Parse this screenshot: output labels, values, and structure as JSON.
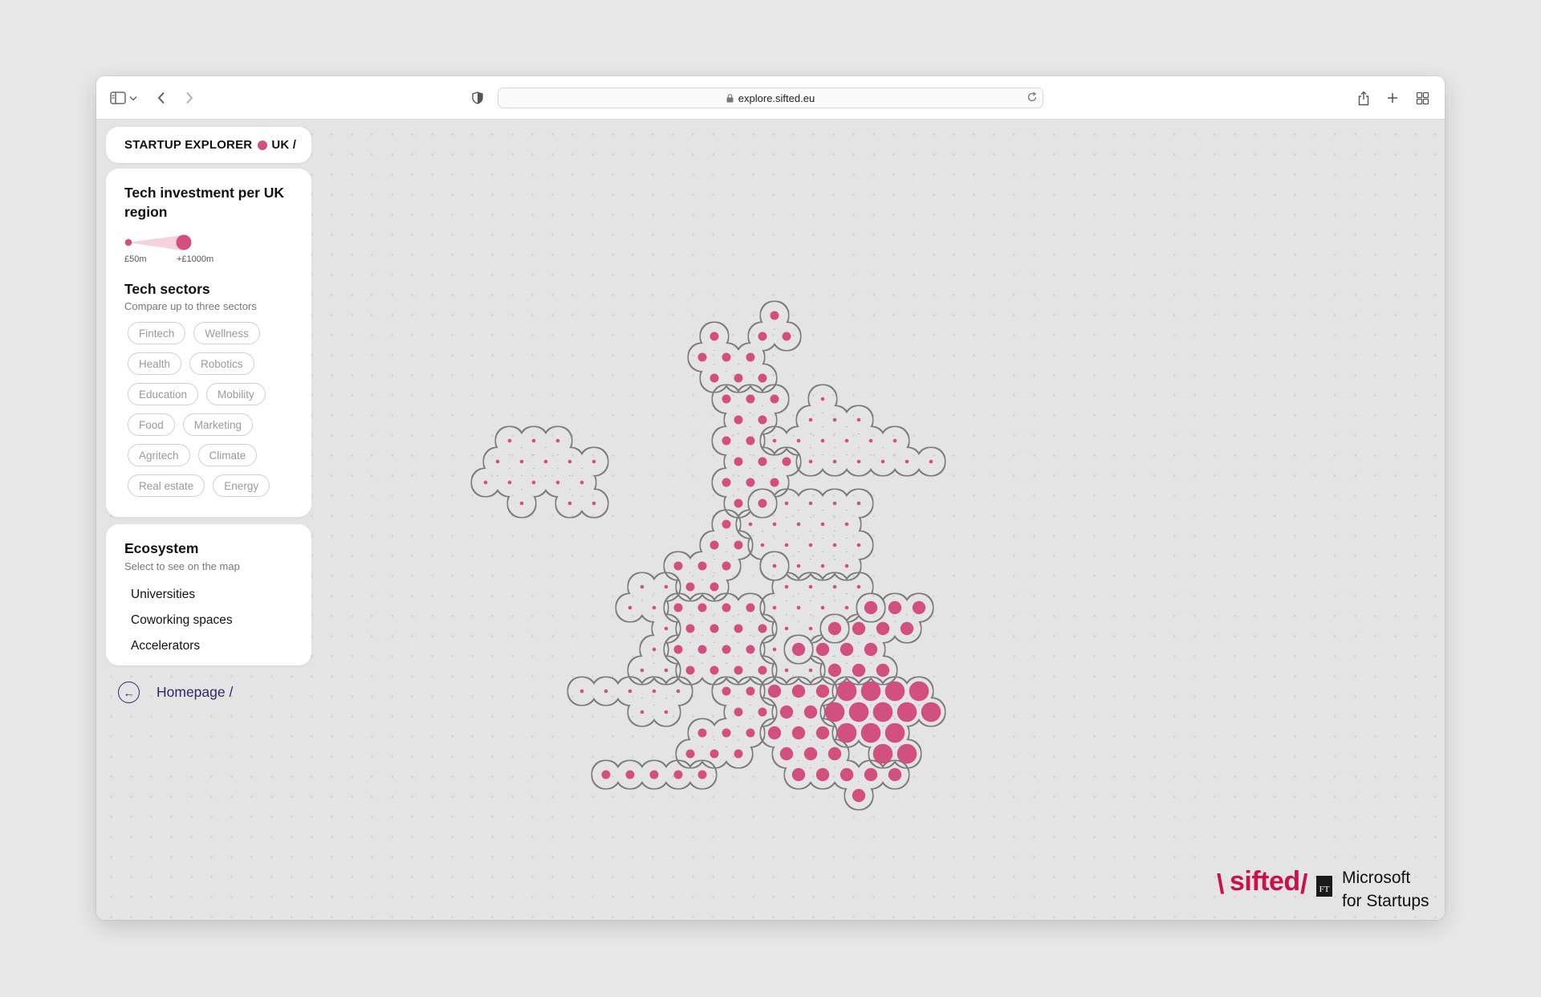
{
  "browser": {
    "url": "explore.sifted.eu",
    "icons": [
      "sidebar-icon",
      "chevron-down-icon",
      "back-icon",
      "forward-icon",
      "shield-icon",
      "lock-icon",
      "reload-icon",
      "share-icon",
      "plus-icon",
      "tabs-grid-icon"
    ]
  },
  "brand": {
    "title": "STARTUP EXPLORER",
    "suffix": "UK /",
    "dot_color": "#d1507f"
  },
  "investment": {
    "title": "Tech investment per UK region",
    "legend_min": "£50m",
    "legend_max": "+£1000m"
  },
  "sectors": {
    "title": "Tech sectors",
    "subtitle": "Compare up to three sectors",
    "rows": [
      [
        "Fintech",
        "Wellness"
      ],
      [
        "Health",
        "Robotics"
      ],
      [
        "Education",
        "Mobility"
      ],
      [
        "Food",
        "Marketing"
      ],
      [
        "Agritech",
        "Climate"
      ],
      [
        "Real estate",
        "Energy"
      ]
    ]
  },
  "ecosystem": {
    "title": "Ecosystem",
    "subtitle": "Select to see on the map",
    "items": [
      "Universities",
      "Coworking spaces",
      "Accelerators"
    ]
  },
  "home_link": "Homepage /",
  "map": {
    "dot_color": "#d1507f",
    "regions": [
      {
        "size": 1,
        "cells": [
          [
            12,
            0
          ],
          [
            9,
            1
          ],
          [
            11,
            1
          ],
          [
            12,
            1
          ],
          [
            9,
            2
          ],
          [
            10,
            2
          ],
          [
            11,
            2
          ],
          [
            9,
            3
          ],
          [
            10,
            3
          ],
          [
            11,
            3
          ]
        ]
      },
      {
        "size": 1,
        "cells": [
          [
            10,
            4
          ],
          [
            11,
            4
          ],
          [
            12,
            4
          ],
          [
            10,
            5
          ],
          [
            11,
            5
          ],
          [
            10,
            6
          ],
          [
            11,
            6
          ],
          [
            10,
            7
          ],
          [
            11,
            7
          ],
          [
            12,
            7
          ],
          [
            10,
            8
          ],
          [
            11,
            8
          ],
          [
            12,
            8
          ],
          [
            10,
            9
          ],
          [
            11,
            9
          ]
        ]
      },
      {
        "size": 0,
        "cells": [
          [
            14,
            4
          ],
          [
            13,
            5
          ],
          [
            14,
            5
          ],
          [
            15,
            5
          ],
          [
            12,
            6
          ],
          [
            13,
            6
          ],
          [
            14,
            6
          ],
          [
            15,
            6
          ],
          [
            16,
            6
          ],
          [
            17,
            6
          ],
          [
            13,
            7
          ],
          [
            14,
            7
          ],
          [
            15,
            7
          ],
          [
            16,
            7
          ],
          [
            17,
            7
          ],
          [
            18,
            7
          ]
        ]
      },
      {
        "size": 0,
        "cells": [
          [
            1,
            6
          ],
          [
            2,
            6
          ],
          [
            3,
            6
          ],
          [
            0,
            7
          ],
          [
            1,
            7
          ],
          [
            2,
            7
          ],
          [
            3,
            7
          ],
          [
            4,
            7
          ],
          [
            0,
            8
          ],
          [
            1,
            8
          ],
          [
            2,
            8
          ],
          [
            3,
            8
          ],
          [
            4,
            8
          ],
          [
            1,
            9
          ],
          [
            3,
            9
          ],
          [
            4,
            9
          ]
        ]
      },
      {
        "size": 1,
        "cells": [
          [
            10,
            10
          ],
          [
            9,
            11
          ],
          [
            10,
            11
          ],
          [
            8,
            12
          ],
          [
            9,
            12
          ],
          [
            10,
            12
          ],
          [
            8,
            13
          ],
          [
            9,
            13
          ]
        ]
      },
      {
        "size": 0,
        "cells": [
          [
            11,
            9
          ],
          [
            12,
            9
          ],
          [
            13,
            9
          ],
          [
            14,
            9
          ],
          [
            15,
            9
          ],
          [
            11,
            10
          ],
          [
            12,
            10
          ],
          [
            13,
            10
          ],
          [
            14,
            10
          ],
          [
            15,
            10
          ],
          [
            11,
            11
          ],
          [
            12,
            11
          ],
          [
            13,
            11
          ],
          [
            14,
            11
          ],
          [
            15,
            11
          ],
          [
            12,
            12
          ],
          [
            13,
            12
          ],
          [
            14,
            12
          ],
          [
            15,
            12
          ]
        ]
      },
      {
        "size": 0,
        "cells": [
          [
            6,
            13
          ],
          [
            7,
            13
          ],
          [
            6,
            14
          ],
          [
            7,
            14
          ],
          [
            7,
            15
          ],
          [
            7,
            16
          ],
          [
            6,
            17
          ],
          [
            7,
            17
          ]
        ]
      },
      {
        "size": 1,
        "cells": [
          [
            8,
            14
          ],
          [
            9,
            14
          ],
          [
            10,
            14
          ],
          [
            11,
            14
          ],
          [
            8,
            15
          ],
          [
            9,
            15
          ],
          [
            10,
            15
          ],
          [
            11,
            15
          ],
          [
            8,
            16
          ],
          [
            9,
            16
          ],
          [
            10,
            16
          ],
          [
            11,
            16
          ],
          [
            8,
            17
          ],
          [
            9,
            17
          ],
          [
            10,
            17
          ],
          [
            11,
            17
          ]
        ]
      },
      {
        "size": 0,
        "cells": [
          [
            12,
            12
          ],
          [
            12,
            13
          ],
          [
            13,
            13
          ],
          [
            14,
            13
          ],
          [
            15,
            13
          ],
          [
            12,
            14
          ],
          [
            13,
            14
          ],
          [
            14,
            14
          ],
          [
            15,
            14
          ],
          [
            16,
            14
          ],
          [
            12,
            15
          ],
          [
            13,
            15
          ],
          [
            14,
            15
          ],
          [
            12,
            16
          ],
          [
            13,
            16
          ],
          [
            12,
            17
          ],
          [
            13,
            17
          ]
        ]
      },
      {
        "size": 2,
        "cells": [
          [
            16,
            14
          ],
          [
            17,
            14
          ],
          [
            18,
            14
          ],
          [
            14,
            15
          ],
          [
            15,
            15
          ],
          [
            16,
            15
          ],
          [
            17,
            15
          ],
          [
            13,
            16
          ],
          [
            14,
            16
          ],
          [
            15,
            16
          ],
          [
            16,
            16
          ],
          [
            14,
            17
          ],
          [
            15,
            17
          ],
          [
            16,
            17
          ]
        ]
      },
      {
        "size": 0,
        "cells": [
          [
            4,
            18
          ],
          [
            5,
            18
          ],
          [
            6,
            18
          ],
          [
            7,
            18
          ],
          [
            8,
            18
          ],
          [
            6,
            19
          ],
          [
            7,
            19
          ]
        ]
      },
      {
        "size": 1,
        "cells": [
          [
            10,
            18
          ],
          [
            11,
            18
          ],
          [
            10,
            19
          ],
          [
            11,
            19
          ],
          [
            9,
            20
          ],
          [
            10,
            20
          ],
          [
            11,
            20
          ],
          [
            8,
            21
          ],
          [
            9,
            21
          ],
          [
            10,
            21
          ]
        ]
      },
      {
        "size": 1,
        "cells": [
          [
            5,
            22
          ],
          [
            6,
            22
          ],
          [
            7,
            22
          ],
          [
            8,
            22
          ],
          [
            9,
            22
          ]
        ]
      },
      {
        "size": 2,
        "cells": [
          [
            12,
            18
          ],
          [
            13,
            18
          ],
          [
            14,
            18
          ],
          [
            12,
            19
          ],
          [
            13,
            19
          ],
          [
            12,
            20
          ],
          [
            13,
            20
          ],
          [
            14,
            20
          ],
          [
            12,
            21
          ],
          [
            13,
            21
          ],
          [
            14,
            21
          ],
          [
            13,
            22
          ],
          [
            14,
            22
          ],
          [
            15,
            22
          ],
          [
            16,
            22
          ],
          [
            17,
            22
          ],
          [
            15,
            23
          ]
        ]
      },
      {
        "size": 3,
        "cells": [
          [
            15,
            18
          ],
          [
            16,
            18
          ],
          [
            17,
            18
          ],
          [
            18,
            18
          ],
          [
            14,
            19
          ],
          [
            15,
            19
          ],
          [
            16,
            19
          ],
          [
            17,
            19
          ],
          [
            18,
            19
          ],
          [
            15,
            20
          ],
          [
            16,
            20
          ],
          [
            17,
            20
          ],
          [
            16,
            21
          ],
          [
            17,
            21
          ]
        ]
      }
    ]
  }
}
